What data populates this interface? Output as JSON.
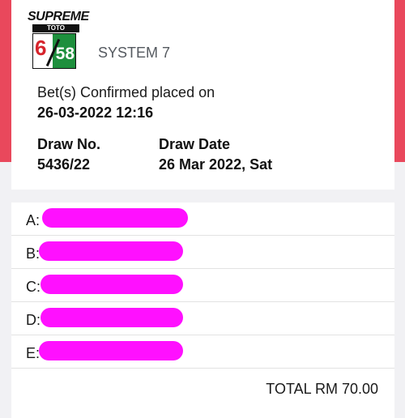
{
  "logo": {
    "brand_text": "SUPREME",
    "sub_text": "TOTO",
    "number_left": "6",
    "number_right": "58"
  },
  "ticket": {
    "game_title": "SYSTEM 7",
    "confirmed_label": "Bet(s) Confirmed placed on",
    "confirmed_time": "26-03-2022 12:16",
    "draw_no_label": "Draw No.",
    "draw_no_value": "5436/22",
    "draw_date_label": "Draw Date",
    "draw_date_value": "26 Mar 2022, Sat"
  },
  "bets": [
    {
      "letter": "A:"
    },
    {
      "letter": "B:"
    },
    {
      "letter": "C:"
    },
    {
      "letter": "D:"
    },
    {
      "letter": "E:"
    }
  ],
  "total": {
    "text": "TOTAL RM 70.00"
  },
  "colors": {
    "header_red": "#e9485c",
    "redaction_magenta": "#ff10ff",
    "logo_green": "#1e8f3d",
    "logo_red": "#d6232b"
  }
}
